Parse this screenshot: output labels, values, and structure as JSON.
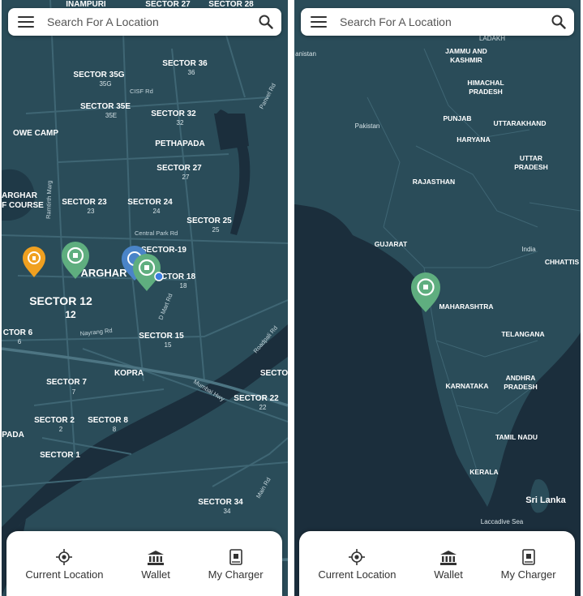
{
  "left_screen": {
    "search": {
      "placeholder": "Search For A Location"
    },
    "map_labels": {
      "inampuri": "INAMPURI",
      "sector27_top": "SECTOR 27",
      "sector28_top": "SECTOR 28",
      "sector35g": "SECTOR 35G",
      "sector35g_sub": "35G",
      "sector36": "SECTOR 36",
      "sector36_sub": "36",
      "cisf_rd": "CISF Rd",
      "panvel_rd": "Panvel Rd",
      "sector35e": "SECTOR 35E",
      "sector35e_sub": "35E",
      "sector32": "SECTOR 32",
      "sector32_sub": "32",
      "owe_camp": "OWE CAMP",
      "pethapada": "PETHAPADA",
      "sector27": "SECTOR 27",
      "sector27_sub": "27",
      "kharghar_line1": "ARGHAR",
      "kharghar_line2": "F COURSE",
      "ramtirth_marg": "Ramtirth Marg",
      "sector23": "SECTOR 23",
      "sector23_sub": "23",
      "sector24": "SECTOR 24",
      "sector24_sub": "24",
      "sector25": "SECTOR 25",
      "sector25_sub": "25",
      "central_park_rd": "Central Park Rd",
      "sector19": "SECTOR-19",
      "kharghar_center": "ARGHAR",
      "sector18": "CTOR 18",
      "sector18_sub": "18",
      "sector12": "SECTOR 12",
      "sector12_sub": "12",
      "d_mart_rd": "D Mart Rd",
      "sector6": "CTOR 6",
      "sector6_sub": "6",
      "nayrang_rd": "Nayrang Rd",
      "sector15": "SECTOR 15",
      "sector15_sub": "15",
      "roadpali_rd": "Roadpali Rd",
      "kopra": "KOPRA",
      "sector_edge": "SECTO",
      "sector7": "SECTOR 7",
      "sector7_sub": "7",
      "mumbai_hwy": "Mumbai Hwy",
      "sector22": "SECTOR 22",
      "sector22_sub": "22",
      "sector2": "SECTOR 2",
      "sector2_sub": "2",
      "sector8": "SECTOR 8",
      "sector8_sub": "8",
      "pada": "PADA",
      "sector1": "SECTOR 1",
      "sector34": "SECTOR 34",
      "sector34_sub": "34",
      "main_rd": "Main Rd"
    },
    "markers": [
      {
        "name": "charger-marker-orange",
        "color": "#f0a020"
      },
      {
        "name": "charger-marker-green-1",
        "color": "#5fae7f"
      },
      {
        "name": "charger-marker-blue",
        "color": "#4a84c8"
      },
      {
        "name": "charger-marker-green-2",
        "color": "#5fae7f"
      }
    ],
    "nav": [
      {
        "label": "Current Location",
        "icon": "crosshair-icon"
      },
      {
        "label": "Wallet",
        "icon": "bank-icon"
      },
      {
        "label": "My Charger",
        "icon": "charger-icon"
      }
    ]
  },
  "right_screen": {
    "search": {
      "placeholder": "Search For A Location"
    },
    "map_labels": {
      "ladakh": "LADAKH",
      "afghanistan": "anistan",
      "jammu_kashmir_1": "JAMMU AND",
      "jammu_kashmir_2": "KASHMIR",
      "himachal_1": "HIMACHAL",
      "himachal_2": "PRADESH",
      "pakistan": "Pakistan",
      "punjab": "PUNJAB",
      "uttarakhand": "UTTARAKHAND",
      "haryana": "HARYANA",
      "uttar_1": "UTTAR",
      "uttar_2": "PRADESH",
      "rajasthan": "RAJASTHAN",
      "gujarat": "GUJARAT",
      "india": "India",
      "chhattisgarh": "CHHATTIS",
      "maharashtra": "MAHARASHTRA",
      "telangana": "TELANGANA",
      "karnataka": "KARNATAKA",
      "andhra_1": "ANDHRA",
      "andhra_2": "PRADESH",
      "tamil_nadu": "TAMIL NADU",
      "kerala": "KERALA",
      "sri_lanka": "Sri Lanka",
      "laccadive_sea": "Laccadive Sea"
    },
    "markers": [
      {
        "name": "charger-marker-green",
        "color": "#5fae7f"
      }
    ],
    "nav": [
      {
        "label": "Current Location",
        "icon": "crosshair-icon"
      },
      {
        "label": "Wallet",
        "icon": "bank-icon"
      },
      {
        "label": "My Charger",
        "icon": "charger-icon"
      }
    ]
  },
  "colors": {
    "land": "#2a4c59",
    "water": "#1b2e3c",
    "road": "#3f6674",
    "marker_green": "#5fae7f",
    "marker_orange": "#f0a020",
    "marker_blue": "#4a84c8"
  }
}
